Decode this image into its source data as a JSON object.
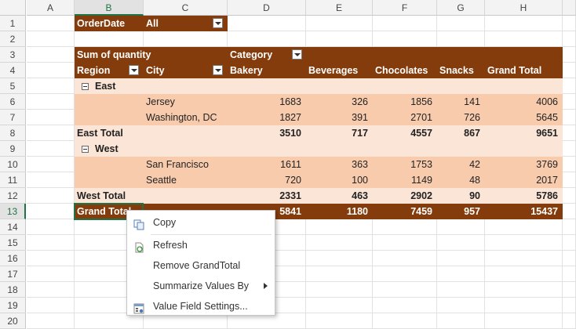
{
  "columns": [
    "A",
    "B",
    "C",
    "D",
    "E",
    "F",
    "G",
    "H"
  ],
  "rows": [
    "1",
    "2",
    "3",
    "4",
    "5",
    "6",
    "7",
    "8",
    "9",
    "10",
    "11",
    "12",
    "13",
    "14",
    "15",
    "16",
    "17",
    "18",
    "19",
    "20"
  ],
  "filter": {
    "label": "OrderDate",
    "value": "All"
  },
  "pivot": {
    "sum_label": "Sum of quantity",
    "category_label": "Category",
    "region_label": "Region",
    "city_label": "City",
    "headers": [
      "Bakery",
      "Beverages",
      "Chocolates",
      "Snacks",
      "Grand Total"
    ],
    "groups": [
      {
        "name": "East",
        "rows": [
          {
            "city": "Jersey",
            "values": [
              "1683",
              "326",
              "1856",
              "141",
              "4006"
            ]
          },
          {
            "city": "Washington, DC",
            "values": [
              "1827",
              "391",
              "2701",
              "726",
              "5645"
            ]
          }
        ],
        "total_label": "East Total",
        "totals": [
          "3510",
          "717",
          "4557",
          "867",
          "9651"
        ]
      },
      {
        "name": "West",
        "rows": [
          {
            "city": "San Francisco",
            "values": [
              "1611",
              "363",
              "1753",
              "42",
              "3769"
            ]
          },
          {
            "city": "Seattle",
            "values": [
              "720",
              "100",
              "1149",
              "48",
              "2017"
            ]
          }
        ],
        "total_label": "West Total",
        "totals": [
          "2331",
          "463",
          "2902",
          "90",
          "5786"
        ]
      }
    ],
    "grand_label": "Grand Total",
    "grand_totals": [
      "5841",
      "1180",
      "7459",
      "957",
      "15437"
    ]
  },
  "context_menu": {
    "copy": "Copy",
    "refresh": "Refresh",
    "remove_grand_total": "Remove GrandTotal",
    "summarize": "Summarize Values By",
    "value_field_settings": "Value Field Settings..."
  },
  "colors": {
    "dark": "#843c0c",
    "light": "#fbe5d6",
    "mid": "#f8cbad",
    "selection": "#217346"
  }
}
